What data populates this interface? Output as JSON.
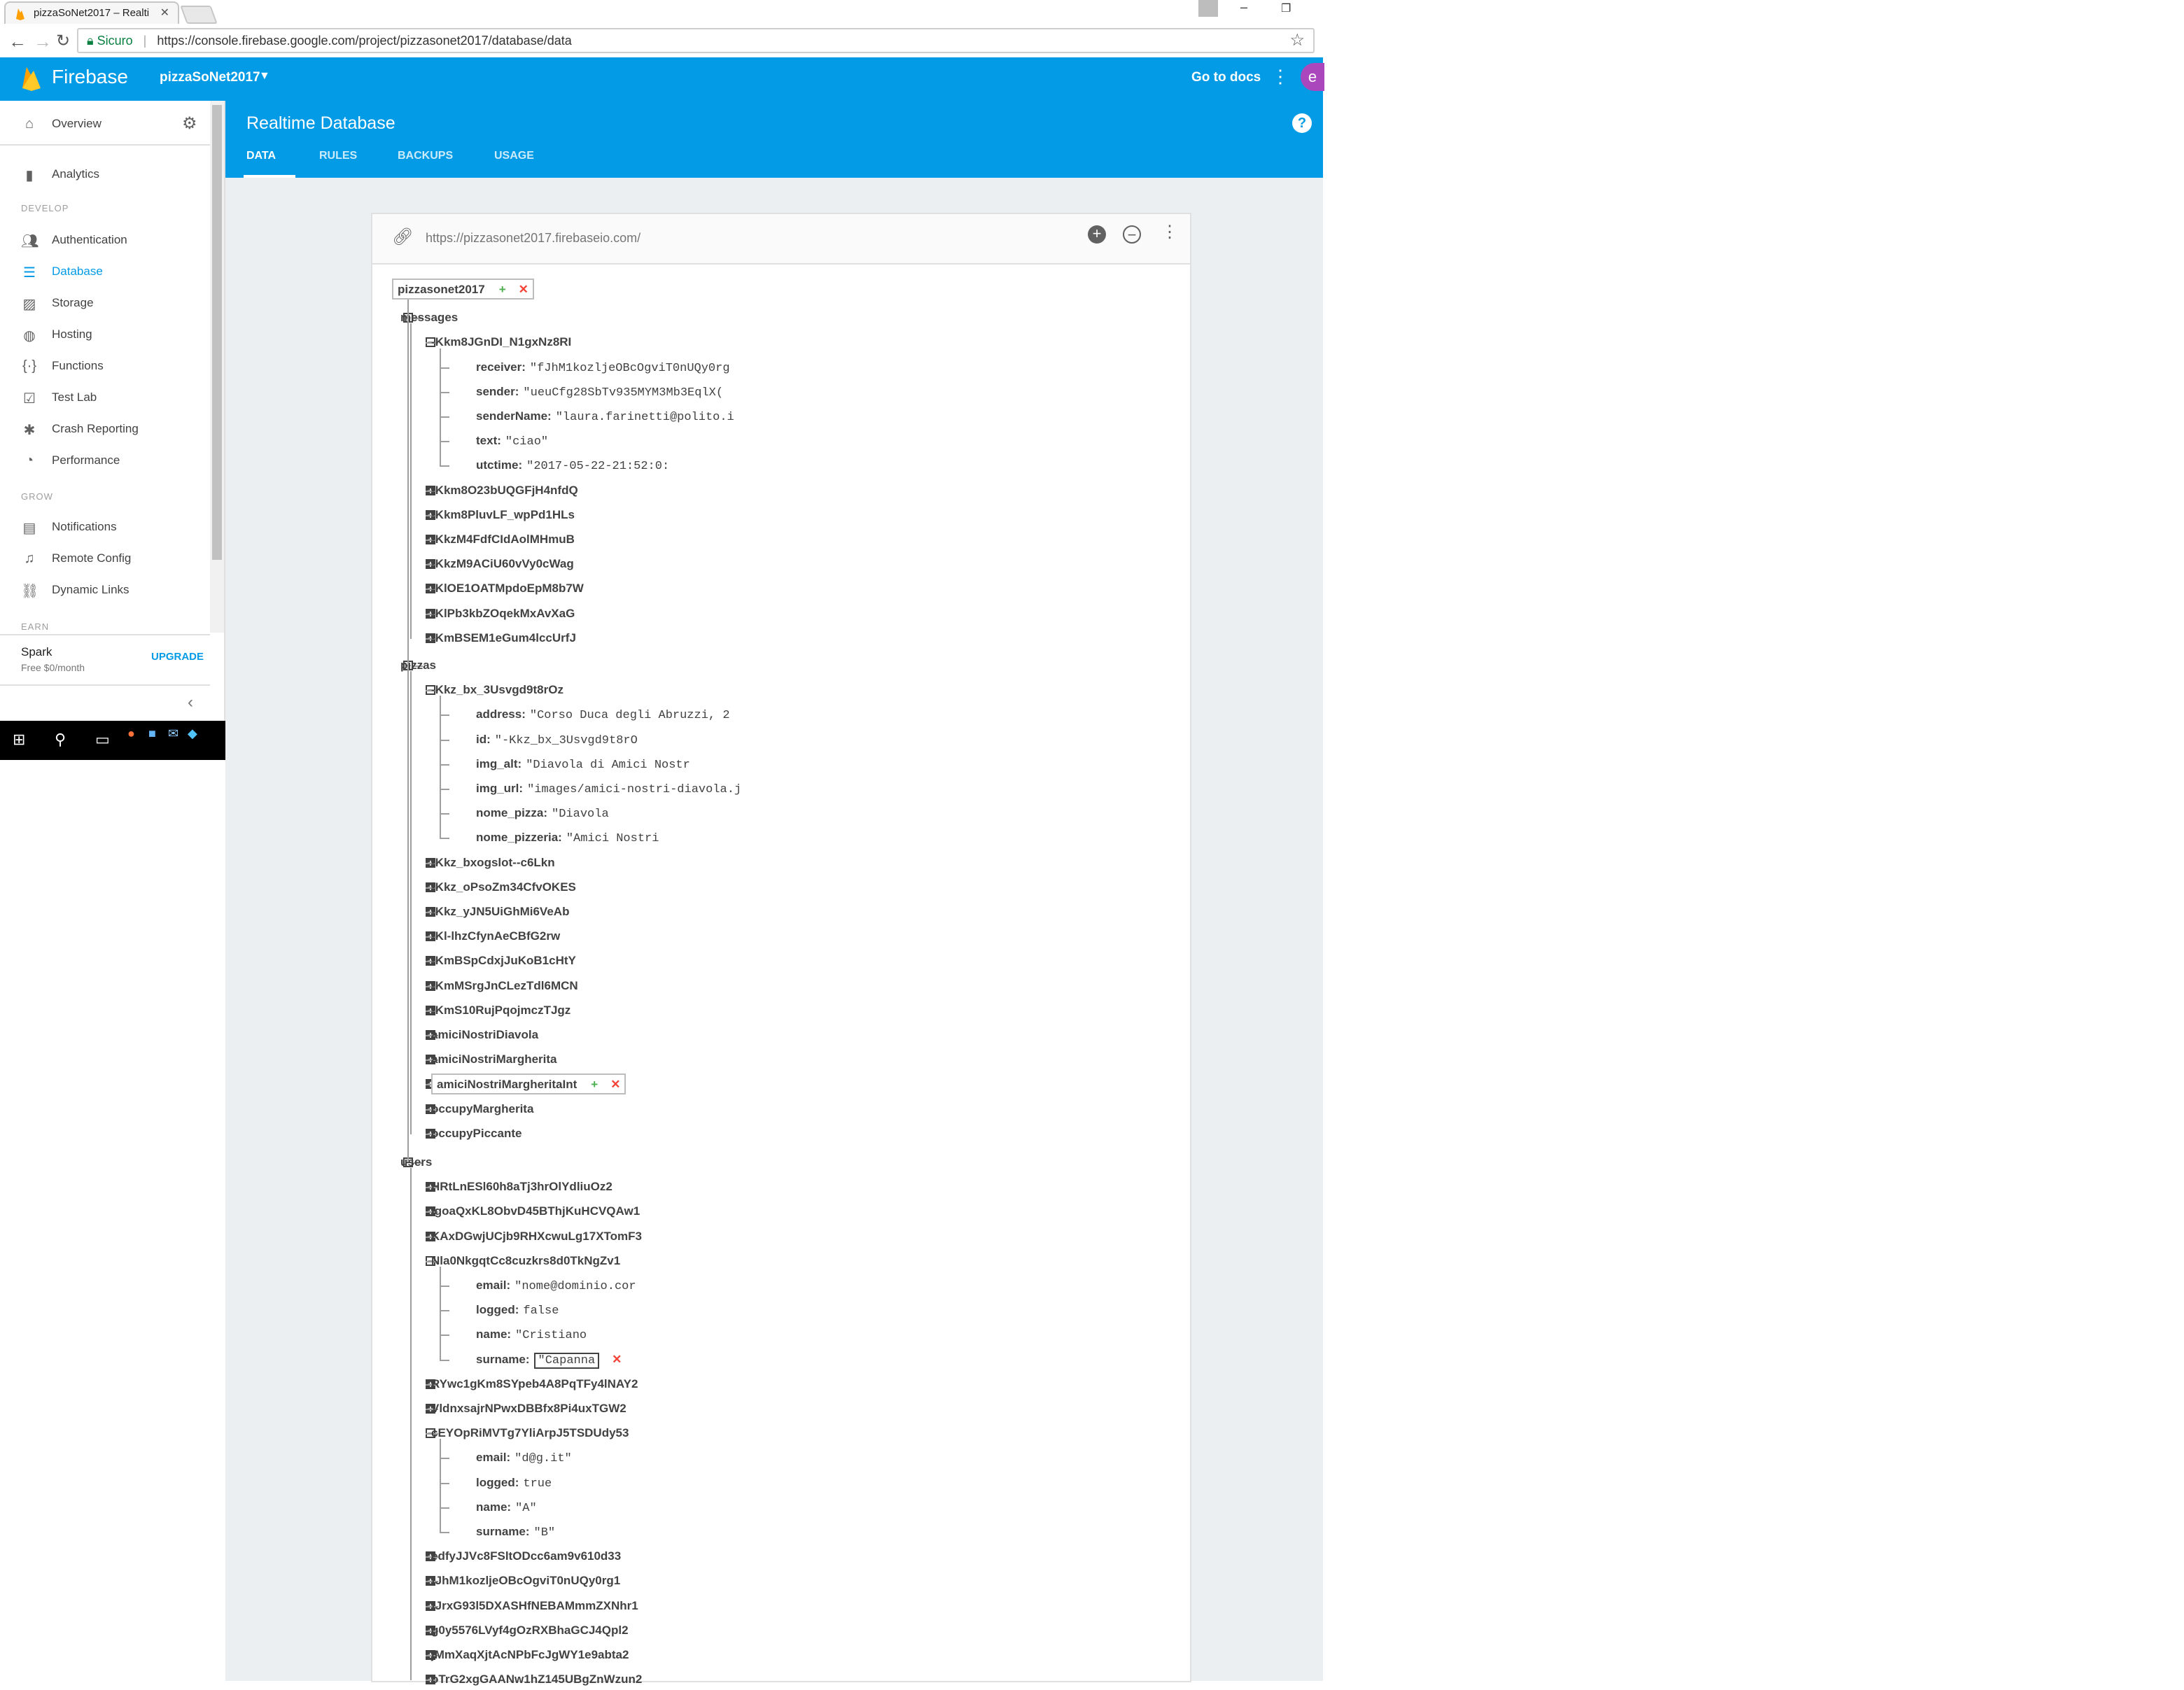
{
  "browser": {
    "tab_title": "pizzaSoNet2017 – Realti",
    "secure_label": "Sicuro",
    "url": "https://console.firebase.google.com/project/pizzasonet2017/database/data"
  },
  "topbar": {
    "brand": "Firebase",
    "project": "pizzaSoNet2017",
    "docs_label": "Go to docs",
    "avatar_letter": "e"
  },
  "sidebar": {
    "overview": "Overview",
    "analytics": "Analytics",
    "section_develop": "DEVELOP",
    "develop": [
      "Authentication",
      "Database",
      "Storage",
      "Hosting",
      "Functions",
      "Test Lab",
      "Crash Reporting",
      "Performance"
    ],
    "section_grow": "GROW",
    "grow": [
      "Notifications",
      "Remote Config",
      "Dynamic Links"
    ],
    "section_earn": "EARN",
    "plan_name": "Spark",
    "plan_price": "Free $0/month",
    "upgrade": "UPGRADE"
  },
  "header": {
    "title": "Realtime Database",
    "tabs": [
      "DATA",
      "RULES",
      "BACKUPS",
      "USAGE"
    ],
    "active_tab": "DATA"
  },
  "database": {
    "url": "https://pizzasonet2017.firebaseio.com/",
    "root": "pizzasonet2017",
    "messages": {
      "key": "messages",
      "expanded_child": {
        "key": "-Kkm8JGnDI_N1gxNz8RI",
        "fields": [
          {
            "k": "receiver:",
            "v": "\"fJhM1kozljeOBcOgviT0nUQy0rg"
          },
          {
            "k": "sender:",
            "v": "\"ueuCfg28SbTv935MYM3Mb3EqlX("
          },
          {
            "k": "senderName:",
            "v": "\"laura.farinetti@polito.i"
          },
          {
            "k": "text:",
            "v": "\"ciao\""
          },
          {
            "k": "utctime:",
            "v": "\"2017-05-22-21:52:0:"
          }
        ]
      },
      "collapsed": [
        "-Kkm8O23bUQGFjH4nfdQ",
        "-Kkm8PluvLF_wpPd1HLs",
        "-KkzM4FdfCIdAolMHmuB",
        "-KkzM9ACiU60vVy0cWag",
        "-KlOE1OATMpdoEpM8b7W",
        "-KlPb3kbZOqekMxAvXaG",
        "-KmBSEM1eGum4lccUrfJ"
      ]
    },
    "pizzas": {
      "key": "pizzas",
      "expanded_child": {
        "key": "-Kkz_bx_3Usvgd9t8rOz",
        "fields": [
          {
            "k": "address:",
            "v": "\"Corso Duca degli Abruzzi, 2"
          },
          {
            "k": "id:",
            "v": "\"-Kkz_bx_3Usvgd9t8rO"
          },
          {
            "k": "img_alt:",
            "v": "\"Diavola di Amici Nostr"
          },
          {
            "k": "img_url:",
            "v": "\"images/amici-nostri-diavola.j"
          },
          {
            "k": "nome_pizza:",
            "v": "\"Diavola"
          },
          {
            "k": "nome_pizzeria:",
            "v": "\"Amici Nostri"
          }
        ]
      },
      "collapsed": [
        "-Kkz_bxogslot--c6Lkn",
        "-Kkz_oPsoZm34CfvOKES",
        "-Kkz_yJN5UiGhMi6VeAb",
        "-Kl-lhzCfynAeCBfG2rw",
        "-KmBSpCdxjJuKoB1cHtY",
        "-KmMSrgJnCLezTdl6MCN",
        "-KmS10RujPqojmczTJgz",
        "amiciNostriDiavola",
        "amiciNostriMargherita",
        "amiciNostriMargheritaInt",
        "occupyMargherita",
        "occupyPiccante"
      ]
    },
    "users": {
      "key": "users",
      "before": [
        "HRtLnESl60h8aTj3hrOlYdliuOz2",
        "IgoaQxKL8ObvD45BThjKuHCVQAw1",
        "KAxDGwjUCjb9RHXcwuLg17XTomF3"
      ],
      "expanded1": {
        "key": "Nla0NkgqtCc8cuzkrs8d0TkNgZv1",
        "fields": [
          {
            "k": "email:",
            "v": "\"nome@dominio.cor"
          },
          {
            "k": "logged:",
            "v": "false"
          },
          {
            "k": "name:",
            "v": "\"Cristiano"
          },
          {
            "k": "surname:",
            "v": "\"Capanna"
          }
        ]
      },
      "middle": [
        "RYwc1gKm8SYpeb4A8PqTFy4lNAY2",
        "VldnxsajrNPwxDBBfx8Pi4uxTGW2"
      ],
      "expanded2": {
        "key": "cEYOpRiMVTg7YliArpJ5TSDUdy53",
        "fields": [
          {
            "k": "email:",
            "v": "\"d@g.it\""
          },
          {
            "k": "logged:",
            "v": "true"
          },
          {
            "k": "name:",
            "v": "\"A\""
          },
          {
            "k": "surname:",
            "v": "\"B\""
          }
        ]
      },
      "after": [
        "edfyJJVc8FSltODcc6am9v610d33",
        "fJhM1kozljeOBcOgviT0nUQy0rg1",
        "fJrxG93l5DXASHfNEBAMmmZXNhr1",
        "g0y5576LVyf4gOzRXBhaGCJ4Qpl2",
        "jMmXaqXjtAcNPbFcJgWY1e9abta2",
        "oTrG2xgGAANw1hZ145UBgZnWzun2"
      ]
    }
  }
}
